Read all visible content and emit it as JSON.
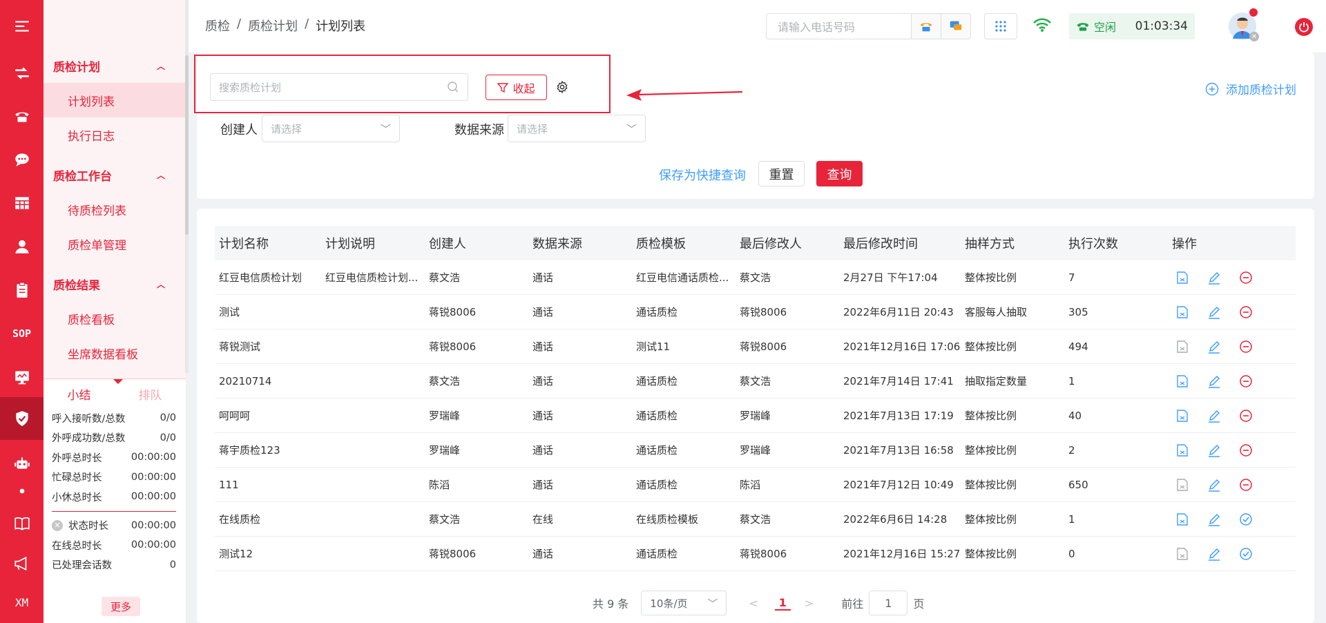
{
  "breadcrumb": [
    "质检",
    "质检计划",
    "计划列表"
  ],
  "header": {
    "phone_placeholder": "请输入电话号码",
    "status_label": "空闲",
    "timer": "01:03:34"
  },
  "rail": {
    "sop_label": "SOP",
    "xm_label": "XM"
  },
  "sidebar": {
    "groups": [
      {
        "title": "质检计划",
        "items": [
          "计划列表",
          "执行日志"
        ]
      },
      {
        "title": "质检工作台",
        "items": [
          "待质检列表",
          "质检单管理"
        ]
      },
      {
        "title": "质检结果",
        "items": [
          "质检看板",
          "坐席数据看板"
        ]
      }
    ]
  },
  "stats": {
    "tabs": [
      "小结",
      "排队"
    ],
    "rows": [
      {
        "label": "呼入接听数/总数",
        "value": "0/0"
      },
      {
        "label": "外呼成功数/总数",
        "value": "0/0"
      },
      {
        "label": "外呼总时长",
        "value": "00:00:00"
      },
      {
        "label": "忙碌总时长",
        "value": "00:00:00"
      },
      {
        "label": "小休总时长",
        "value": "00:00:00"
      }
    ],
    "rows2": [
      {
        "label": "状态时长",
        "value": "00:00:00"
      },
      {
        "label": "在线总时长",
        "value": "00:00:00"
      },
      {
        "label": "已处理会话数",
        "value": "0"
      }
    ],
    "more": "更多"
  },
  "search": {
    "placeholder": "搜索质检计划",
    "collapse": "收起",
    "add_plan": "添加质检计划",
    "creator_label": "创建人",
    "source_label": "数据来源",
    "select_placeholder": "请选择",
    "save_quick": "保存为快捷查询",
    "reset": "重置",
    "query": "查询"
  },
  "table": {
    "columns": [
      "计划名称",
      "计划说明",
      "创建人",
      "数据来源",
      "质检模板",
      "最后修改人",
      "最后修改时间",
      "抽样方式",
      "执行次数",
      "操作"
    ],
    "rows": [
      [
        "红豆电信质检计划",
        "红豆电信质检计划...",
        "蔡文浩",
        "通话",
        "红豆电信通话质检...",
        "蔡文浩",
        "2月27日 下午17:04",
        "整体按比例",
        "7",
        "stop"
      ],
      [
        "测试",
        "",
        "蒋锐8006",
        "通话",
        "通话质检",
        "蒋锐8006",
        "2022年6月11日 20:43",
        "客服每人抽取",
        "305",
        "stop"
      ],
      [
        "蒋锐测试",
        "",
        "蒋锐8006",
        "通话",
        "测试11",
        "蒋锐8006",
        "2021年12月16日 17:06",
        "整体按比例",
        "494",
        "stop"
      ],
      [
        "20210714",
        "",
        "蔡文浩",
        "通话",
        "通话质检",
        "蔡文浩",
        "2021年7月14日 17:41",
        "抽取指定数量",
        "1",
        "stop"
      ],
      [
        "呵呵呵",
        "",
        "罗瑞峰",
        "通话",
        "通话质检",
        "罗瑞峰",
        "2021年7月13日 17:19",
        "整体按比例",
        "40",
        "stop"
      ],
      [
        "蒋宇质检123",
        "",
        "罗瑞峰",
        "通话",
        "通话质检",
        "罗瑞峰",
        "2021年7月13日 16:58",
        "整体按比例",
        "2",
        "stop"
      ],
      [
        "111",
        "",
        "陈滔",
        "通话",
        "通话质检",
        "陈滔",
        "2021年7月12日 10:49",
        "整体按比例",
        "650",
        "stop"
      ],
      [
        "在线质检",
        "",
        "蔡文浩",
        "在线",
        "在线质检模板",
        "蔡文浩",
        "2022年6月6日 14:28",
        "整体按比例",
        "1",
        "start"
      ],
      [
        "测试12",
        "",
        "蒋锐8006",
        "通话",
        "通话质检",
        "蒋锐8006",
        "2021年12月16日 15:27",
        "整体按比例",
        "0",
        "start"
      ]
    ],
    "first_icon_gray": [
      false,
      false,
      true,
      false,
      false,
      false,
      true,
      false,
      true
    ]
  },
  "pager": {
    "total": "共 9 条",
    "page_size": "10条/页",
    "current": "1",
    "goto_label": "前往",
    "goto_value": "1",
    "page_suffix": "页"
  },
  "colors": {
    "brand": "#e8243a",
    "link": "#409eff"
  }
}
